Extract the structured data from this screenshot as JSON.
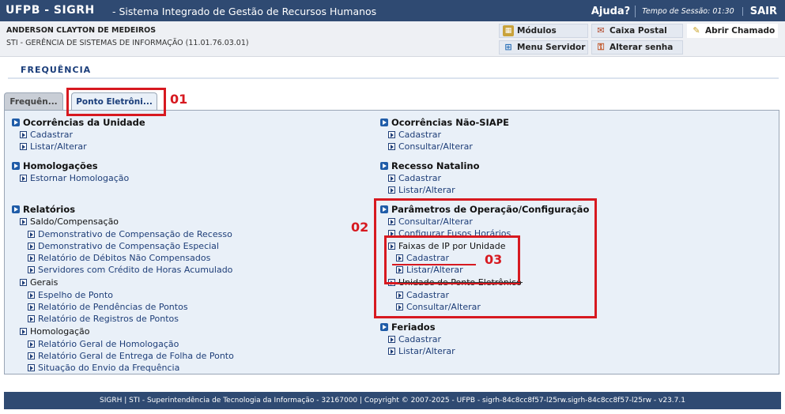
{
  "topbar": {
    "brand": "UFPB - SIGRH",
    "subtitle": "- Sistema Integrado de Gestão de Recursos Humanos",
    "ajuda": "Ajuda?",
    "sessao": "Tempo de Sessão: 01:30",
    "sair": "SAIR"
  },
  "user": {
    "name": "ANDERSON CLAYTON DE MEDEIROS",
    "unit": "STI - GERÊNCIA DE SISTEMAS DE INFORMAÇÃO (11.01.76.03.01)"
  },
  "quick": {
    "modulos": "Módulos",
    "caixa": "Caixa Postal",
    "chamado": "Abrir Chamado",
    "menu": "Menu Servidor",
    "senha": "Alterar senha"
  },
  "page_title": "FREQUÊNCIA",
  "tabs": {
    "t1": "Frequên...",
    "t2": "Ponto Eletrôni..."
  },
  "annotations": {
    "a1": "01",
    "a2": "02",
    "a3": "03"
  },
  "left": {
    "ocorr": "Ocorrências da Unidade",
    "ocorr_cad": "Cadastrar",
    "ocorr_list": "Listar/Alterar",
    "homol": "Homologações",
    "homol_est": "Estornar Homologação",
    "rel": "Relatórios",
    "saldo": "Saldo/Compensação",
    "saldo_1": "Demonstrativo de Compensação de Recesso",
    "saldo_2": "Demonstrativo de Compensação Especial",
    "saldo_3": "Relatório de Débitos Não Compensados",
    "saldo_4": "Servidores com Crédito de Horas Acumulado",
    "gerais": "Gerais",
    "gerais_1": "Espelho de Ponto",
    "gerais_2": "Relatório de Pendências de Pontos",
    "gerais_3": "Relatório de Registros de Pontos",
    "homo2": "Homologação",
    "homo2_1": "Relatório Geral de Homologação",
    "homo2_2": "Relatório Geral de Entrega de Folha de Ponto",
    "homo2_3": "Situação do Envio da Frequência"
  },
  "right": {
    "nsiape": "Ocorrências Não-SIAPE",
    "nsiape_cad": "Cadastrar",
    "nsiape_cons": "Consultar/Alterar",
    "recesso": "Recesso Natalino",
    "recesso_cad": "Cadastrar",
    "recesso_list": "Listar/Alterar",
    "param": "Parâmetros de Operação/Configuração",
    "param_cons": "Consultar/Alterar",
    "param_fuso": "Configurar Fusos Horários",
    "faixas": "Faixas de IP por Unidade",
    "faixas_cad": "Cadastrar",
    "faixas_list": "Listar/Alterar",
    "unid": "Unidade de Ponto Eletrônico",
    "unid_cad": "Cadastrar",
    "unid_cons": "Consultar/Alterar",
    "feriados": "Feriados",
    "fer_cad": "Cadastrar",
    "fer_list": "Listar/Alterar"
  },
  "footer": "SIGRH | STI - Superintendência de Tecnologia da Informação - 32167000 | Copyright © 2007-2025 - UFPB - sigrh-84c8cc8f57-l25rw.sigrh-84c8cc8f57-l25rw - v23.7.1"
}
